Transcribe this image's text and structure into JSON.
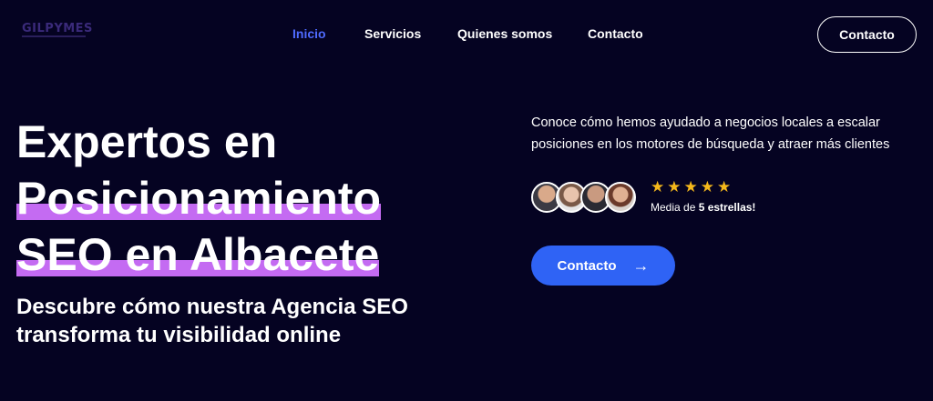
{
  "brand": {
    "logo_text": "GILPYMES"
  },
  "nav": {
    "items": [
      {
        "label": "Inicio",
        "active": true
      },
      {
        "label": "Servicios",
        "active": false
      },
      {
        "label": "Quienes somos",
        "active": false
      },
      {
        "label": "Contacto",
        "active": false
      }
    ],
    "cta_label": "Contacto"
  },
  "hero": {
    "line1": "Expertos en",
    "line2": "Posicionamiento",
    "line3": "SEO en Albacete",
    "subtitle": "Descubre cómo nuestra Agencia SEO transforma tu visibilidad online",
    "description": "Conoce cómo hemos ayudado a negocios locales a escalar posiciones en los motores de búsqueda y atraer más clientes",
    "stars": "★★★★★",
    "rating_prefix": "Media de ",
    "rating_bold": "5 estrellas!",
    "cta_label": "Contacto",
    "cta_icon": "arrow-right-icon"
  },
  "colors": {
    "background": "#050322",
    "accent": "#2f63f5",
    "highlight": "#c46bf2",
    "nav_active": "#4f6bff",
    "stars": "#f5b81b"
  }
}
